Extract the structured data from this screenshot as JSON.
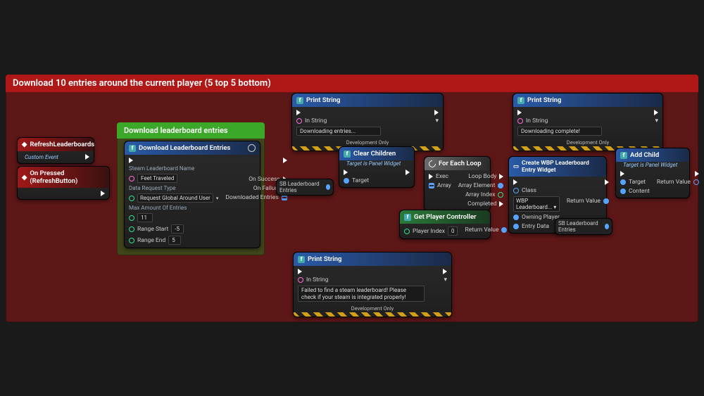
{
  "comments": {
    "red": {
      "title": "Download 10 entries around the current player (5 top 5 bottom)",
      "bg": "#b01818",
      "body_bg": "rgba(120,22,22,0.72)"
    },
    "green": {
      "title": "Download leaderboard entries",
      "bg": "#3ca82a",
      "body_bg": "rgba(40,110,30,0.55)"
    }
  },
  "events": {
    "refresh_lb": {
      "title": "RefreshLeaderboards",
      "sub": "Custom Event"
    },
    "on_pressed": {
      "title": "On Pressed (RefreshButton)"
    }
  },
  "download": {
    "title": "Download Leaderboard Entries",
    "p_name_label": "Steam Leaderboard Name",
    "p_name_value": "Feet Traveled",
    "p_type_label": "Data Request Type",
    "p_type_value": "Request Global Around User",
    "p_max_label": "Max Amount Of Entries",
    "p_max_value": "11",
    "p_rstart_label": "Range Start",
    "p_rstart_value": "-5",
    "p_rend_label": "Range End",
    "p_rend_value": "5",
    "out_success": "On Success",
    "out_failure": "On Failure",
    "out_entries": "Downloaded Entries"
  },
  "print1": {
    "title": "Print String",
    "in_str": "In String",
    "val": "Downloading entries...",
    "dev": "Development Only"
  },
  "print2": {
    "title": "Print String",
    "in_str": "In String",
    "val": "Downloading complete!",
    "dev": "Development Only"
  },
  "print3": {
    "title": "Print String",
    "in_str": "In String",
    "val": "Failed to find a steam leaderboard! Please check if your steam is integrated properly!",
    "dev": "Development Only"
  },
  "clear": {
    "title": "Clear Children",
    "sub": "Target is Panel Widget",
    "p_target": "Target"
  },
  "foreach": {
    "title": "For Each Loop",
    "p_exec": "Exec",
    "p_array": "Array",
    "o_body": "Loop Body",
    "o_elem": "Array Element",
    "o_idx": "Array Index",
    "o_done": "Completed"
  },
  "getpc": {
    "title": "Get Player Controller",
    "p_idx": "Player Index",
    "p_idx_val": "0",
    "o_ret": "Return Value"
  },
  "create": {
    "title": "Create WBP Leaderboard Entry Widget",
    "p_class": "Class",
    "p_class_val": "WBP Leaderboard...",
    "p_owner": "Owning Player",
    "p_entry": "Entry Data",
    "o_ret": "Return Value"
  },
  "addchild": {
    "title": "Add Child",
    "sub": "Target is Panel Widget",
    "p_target": "Target",
    "p_content": "Content",
    "o_ret": "Return Value"
  },
  "reroutes": {
    "sb1": "SB Leaderboard Entries",
    "sb2": "SB Leaderboard Entries"
  },
  "colors": {
    "hdr_event": "linear-gradient(90deg,#a01818,#3a1010)",
    "hdr_async": "linear-gradient(90deg,#2a5aa8,#1a2a48)",
    "hdr_func": "linear-gradient(90deg,#2a5aa8,#1a2a48)",
    "hdr_macro": "linear-gradient(90deg,#6a6a6a,#2a2a2a)",
    "hdr_pure": "linear-gradient(90deg,#2a7a3a,#1a3a20)"
  }
}
